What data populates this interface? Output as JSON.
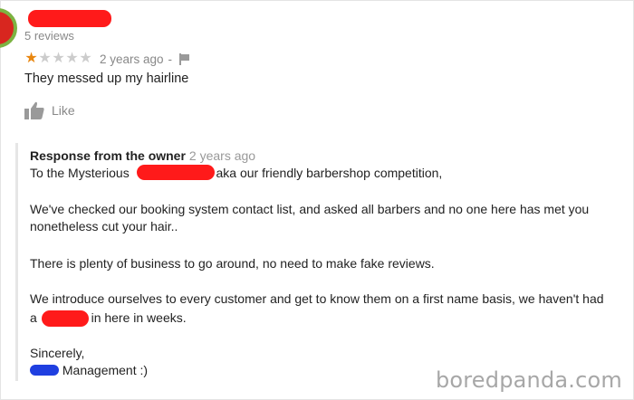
{
  "review": {
    "reviewer_count": "5 reviews",
    "rating": {
      "value": 1,
      "max": 5
    },
    "time": "2 years ago",
    "separator": "-",
    "text": "They messed up my hairline",
    "like_label": "Like"
  },
  "owner_response": {
    "heading": "Response from the owner",
    "time": "2 years ago",
    "line1_a": "To the Mysterious",
    "line1_b": "aka our friendly barbershop competition,",
    "para2_line1": "We've checked our booking system contact list, and asked all barbers and no one here has met you",
    "para2_line2": "nonetheless cut your hair..",
    "para3": "There is plenty of business to go around, no need to make fake reviews.",
    "para4_line1": "We introduce ourselves to every customer and get to know them on a first name basis, we haven't had",
    "para4_line2_a": "a",
    "para4_line2_b": "in here in weeks.",
    "signoff": "Sincerely,",
    "signature": "Management :)"
  },
  "watermark": "boredpanda.com",
  "colors": {
    "star_filled": "#e8860f",
    "star_empty": "#cccccc",
    "redaction_red": "#ff1a1a",
    "redaction_blue": "#1f3fe0",
    "muted_text": "#888888"
  }
}
